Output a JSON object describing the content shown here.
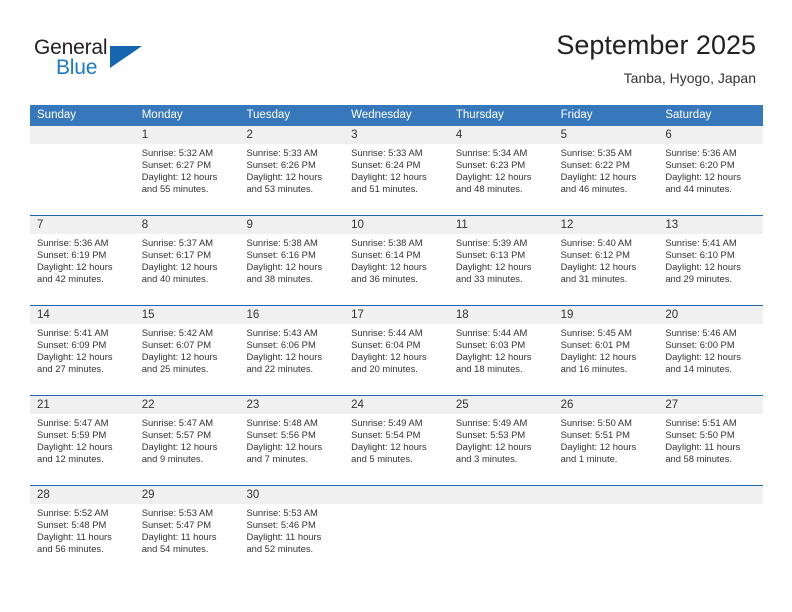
{
  "logo": {
    "word_top": "General",
    "word_bottom": "Blue",
    "triangle_color": "#1565b0"
  },
  "header": {
    "title": "September 2025",
    "location": "Tanba, Hyogo, Japan"
  },
  "colors": {
    "header_row_bg": "#3778bc",
    "week_separator": "#1f66ad",
    "daynum_band_bg": "#f0f0f0",
    "text": "#333333"
  },
  "day_headers": [
    "Sunday",
    "Monday",
    "Tuesday",
    "Wednesday",
    "Thursday",
    "Friday",
    "Saturday"
  ],
  "weeks": [
    {
      "days": [
        {
          "date": "",
          "lines": []
        },
        {
          "date": "1",
          "lines": [
            "Sunrise: 5:32 AM",
            "Sunset: 6:27 PM",
            "Daylight: 12 hours",
            "and 55 minutes."
          ]
        },
        {
          "date": "2",
          "lines": [
            "Sunrise: 5:33 AM",
            "Sunset: 6:26 PM",
            "Daylight: 12 hours",
            "and 53 minutes."
          ]
        },
        {
          "date": "3",
          "lines": [
            "Sunrise: 5:33 AM",
            "Sunset: 6:24 PM",
            "Daylight: 12 hours",
            "and 51 minutes."
          ]
        },
        {
          "date": "4",
          "lines": [
            "Sunrise: 5:34 AM",
            "Sunset: 6:23 PM",
            "Daylight: 12 hours",
            "and 48 minutes."
          ]
        },
        {
          "date": "5",
          "lines": [
            "Sunrise: 5:35 AM",
            "Sunset: 6:22 PM",
            "Daylight: 12 hours",
            "and 46 minutes."
          ]
        },
        {
          "date": "6",
          "lines": [
            "Sunrise: 5:36 AM",
            "Sunset: 6:20 PM",
            "Daylight: 12 hours",
            "and 44 minutes."
          ]
        }
      ]
    },
    {
      "days": [
        {
          "date": "7",
          "lines": [
            "Sunrise: 5:36 AM",
            "Sunset: 6:19 PM",
            "Daylight: 12 hours",
            "and 42 minutes."
          ]
        },
        {
          "date": "8",
          "lines": [
            "Sunrise: 5:37 AM",
            "Sunset: 6:17 PM",
            "Daylight: 12 hours",
            "and 40 minutes."
          ]
        },
        {
          "date": "9",
          "lines": [
            "Sunrise: 5:38 AM",
            "Sunset: 6:16 PM",
            "Daylight: 12 hours",
            "and 38 minutes."
          ]
        },
        {
          "date": "10",
          "lines": [
            "Sunrise: 5:38 AM",
            "Sunset: 6:14 PM",
            "Daylight: 12 hours",
            "and 36 minutes."
          ]
        },
        {
          "date": "11",
          "lines": [
            "Sunrise: 5:39 AM",
            "Sunset: 6:13 PM",
            "Daylight: 12 hours",
            "and 33 minutes."
          ]
        },
        {
          "date": "12",
          "lines": [
            "Sunrise: 5:40 AM",
            "Sunset: 6:12 PM",
            "Daylight: 12 hours",
            "and 31 minutes."
          ]
        },
        {
          "date": "13",
          "lines": [
            "Sunrise: 5:41 AM",
            "Sunset: 6:10 PM",
            "Daylight: 12 hours",
            "and 29 minutes."
          ]
        }
      ]
    },
    {
      "days": [
        {
          "date": "14",
          "lines": [
            "Sunrise: 5:41 AM",
            "Sunset: 6:09 PM",
            "Daylight: 12 hours",
            "and 27 minutes."
          ]
        },
        {
          "date": "15",
          "lines": [
            "Sunrise: 5:42 AM",
            "Sunset: 6:07 PM",
            "Daylight: 12 hours",
            "and 25 minutes."
          ]
        },
        {
          "date": "16",
          "lines": [
            "Sunrise: 5:43 AM",
            "Sunset: 6:06 PM",
            "Daylight: 12 hours",
            "and 22 minutes."
          ]
        },
        {
          "date": "17",
          "lines": [
            "Sunrise: 5:44 AM",
            "Sunset: 6:04 PM",
            "Daylight: 12 hours",
            "and 20 minutes."
          ]
        },
        {
          "date": "18",
          "lines": [
            "Sunrise: 5:44 AM",
            "Sunset: 6:03 PM",
            "Daylight: 12 hours",
            "and 18 minutes."
          ]
        },
        {
          "date": "19",
          "lines": [
            "Sunrise: 5:45 AM",
            "Sunset: 6:01 PM",
            "Daylight: 12 hours",
            "and 16 minutes."
          ]
        },
        {
          "date": "20",
          "lines": [
            "Sunrise: 5:46 AM",
            "Sunset: 6:00 PM",
            "Daylight: 12 hours",
            "and 14 minutes."
          ]
        }
      ]
    },
    {
      "days": [
        {
          "date": "21",
          "lines": [
            "Sunrise: 5:47 AM",
            "Sunset: 5:59 PM",
            "Daylight: 12 hours",
            "and 12 minutes."
          ]
        },
        {
          "date": "22",
          "lines": [
            "Sunrise: 5:47 AM",
            "Sunset: 5:57 PM",
            "Daylight: 12 hours",
            "and 9 minutes."
          ]
        },
        {
          "date": "23",
          "lines": [
            "Sunrise: 5:48 AM",
            "Sunset: 5:56 PM",
            "Daylight: 12 hours",
            "and 7 minutes."
          ]
        },
        {
          "date": "24",
          "lines": [
            "Sunrise: 5:49 AM",
            "Sunset: 5:54 PM",
            "Daylight: 12 hours",
            "and 5 minutes."
          ]
        },
        {
          "date": "25",
          "lines": [
            "Sunrise: 5:49 AM",
            "Sunset: 5:53 PM",
            "Daylight: 12 hours",
            "and 3 minutes."
          ]
        },
        {
          "date": "26",
          "lines": [
            "Sunrise: 5:50 AM",
            "Sunset: 5:51 PM",
            "Daylight: 12 hours",
            "and 1 minute."
          ]
        },
        {
          "date": "27",
          "lines": [
            "Sunrise: 5:51 AM",
            "Sunset: 5:50 PM",
            "Daylight: 11 hours",
            "and 58 minutes."
          ]
        }
      ]
    },
    {
      "days": [
        {
          "date": "28",
          "lines": [
            "Sunrise: 5:52 AM",
            "Sunset: 5:48 PM",
            "Daylight: 11 hours",
            "and 56 minutes."
          ]
        },
        {
          "date": "29",
          "lines": [
            "Sunrise: 5:53 AM",
            "Sunset: 5:47 PM",
            "Daylight: 11 hours",
            "and 54 minutes."
          ]
        },
        {
          "date": "30",
          "lines": [
            "Sunrise: 5:53 AM",
            "Sunset: 5:46 PM",
            "Daylight: 11 hours",
            "and 52 minutes."
          ]
        },
        {
          "date": "",
          "lines": []
        },
        {
          "date": "",
          "lines": []
        },
        {
          "date": "",
          "lines": []
        },
        {
          "date": "",
          "lines": []
        }
      ]
    }
  ]
}
